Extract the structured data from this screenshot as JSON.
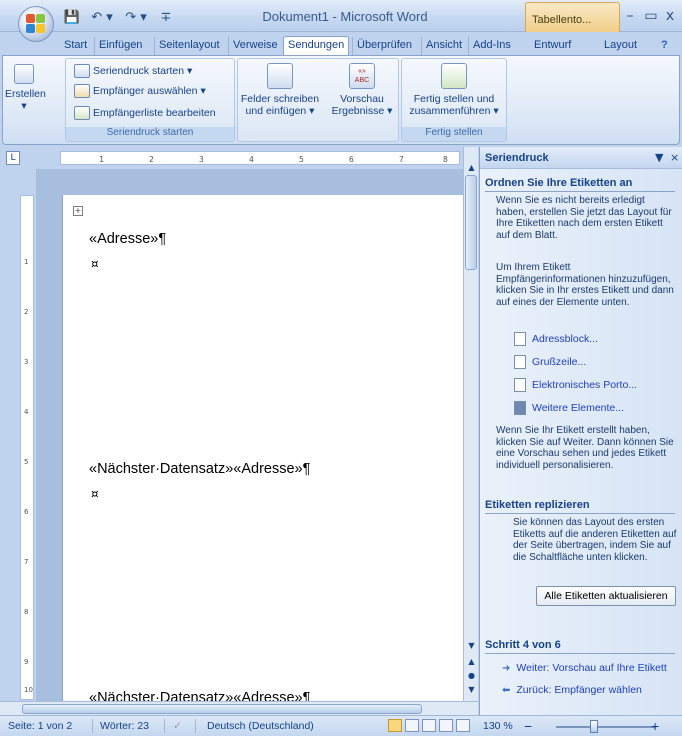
{
  "window": {
    "title": "Dokument1 - Microsoft Word",
    "context_group": "Tabellento...",
    "minimize": "–",
    "maximize": "▭",
    "close": "x"
  },
  "qat": {
    "save": "💾",
    "undo": "↶ ▾",
    "redo": "↷ ▾",
    "customize": "∓"
  },
  "tabs": [
    "Start",
    "Einfügen",
    "Seitenlayout",
    "Verweise",
    "Sendungen",
    "Überprüfen",
    "Ansicht",
    "Add-Ins"
  ],
  "active_tab": "Sendungen",
  "context_tabs": [
    "Entwurf",
    "Layout"
  ],
  "help": "?",
  "ribbon": {
    "erstellen": "Erstellen",
    "seriendruck_starten": "Seriendruck starten",
    "empfaenger_auswaehlen": "Empfänger auswählen",
    "empfaengerliste_bearbeiten": "Empfängerliste bearbeiten",
    "group1_label": "Seriendruck starten",
    "felder_line1": "Felder schreiben",
    "felder_line2": "und einfügen",
    "vorschau_line1": "Vorschau",
    "vorschau_line2": "Ergebnisse",
    "vorschau_icon": "«»\nABC",
    "fertig_line1": "Fertig stellen und",
    "fertig_line2": "zusammenführen",
    "group2_label": "Fertig stellen"
  },
  "ruler": {
    "marks": [
      "1",
      "2",
      "3",
      "4",
      "5",
      "6",
      "7",
      "8"
    ],
    "vmarks": [
      "1",
      "2",
      "3",
      "4",
      "5",
      "6",
      "7",
      "8",
      "9",
      "10"
    ]
  },
  "document": {
    "line1": "«Adresse»¶",
    "cell1": "¤",
    "line2": "«Nächster·Datensatz»«Adresse»¶",
    "cell2": "¤",
    "line3": "«Nächster·Datensatz»«Adresse»¶"
  },
  "taskpane": {
    "title": "Seriendruck",
    "section1": "Ordnen Sie Ihre Etiketten an",
    "para1": "Wenn Sie es nicht bereits erledigt haben, erstellen Sie jetzt das Layout für Ihre Etiketten nach dem ersten Etikett auf dem Blatt.",
    "para2": "Um Ihrem Etikett Empfängerinformationen hinzuzufügen, klicken Sie in Ihr erstes Etikett und dann auf eines der Elemente unten.",
    "links": [
      "Adressblock...",
      "Grußzeile...",
      "Elektronisches Porto...",
      "Weitere Elemente..."
    ],
    "para3": "Wenn Sie Ihr Etikett erstellt haben, klicken Sie auf Weiter. Dann können Sie eine Vorschau sehen und jedes Etikett individuell personalisieren.",
    "section2": "Etiketten replizieren",
    "para4": "Sie können das Layout des ersten Etiketts auf die anderen Etiketten auf der Seite übertragen, indem Sie auf die Schaltfläche unten klicken.",
    "update_button": "Alle Etiketten aktualisieren",
    "step": "Schritt 4 von 6",
    "next": "Weiter: Vorschau auf Ihre Etikett",
    "back": "Zurück: Empfänger wählen"
  },
  "statusbar": {
    "page": "Seite: 1 von 2",
    "words": "Wörter: 23",
    "language": "Deutsch (Deutschland)",
    "zoom": "130 %",
    "zoom_minus": "−",
    "zoom_plus": "+"
  }
}
